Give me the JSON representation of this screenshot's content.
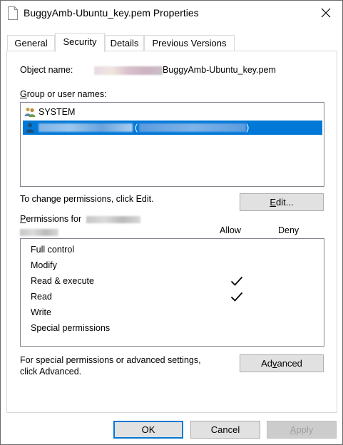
{
  "window": {
    "title": "BuggyAmb-Ubuntu_key.pem Properties"
  },
  "tabs": [
    {
      "label": "General"
    },
    {
      "label": "Security"
    },
    {
      "label": "Details"
    },
    {
      "label": "Previous Versions"
    }
  ],
  "security": {
    "object_name_label": "Object name:",
    "object_name_value": "BuggyAmb-Ubuntu_key.pem",
    "groups_label_prefix": "G",
    "groups_label_rest": "roup or user names:",
    "users": [
      {
        "name": "SYSTEM",
        "icon": "users-group-icon",
        "selected": false
      },
      {
        "name": "(",
        "name_end": ")",
        "icon": "user-icon",
        "selected": true
      }
    ],
    "change_text": "To change permissions, click Edit.",
    "edit_prefix": "E",
    "edit_rest": "dit...",
    "permissions_for_prefix": "P",
    "permissions_for_rest": "ermissions for",
    "allow_header": "Allow",
    "deny_header": "Deny",
    "permissions": [
      {
        "name": "Full control",
        "allow": false,
        "deny": false
      },
      {
        "name": "Modify",
        "allow": false,
        "deny": false
      },
      {
        "name": "Read & execute",
        "allow": true,
        "deny": false
      },
      {
        "name": "Read",
        "allow": true,
        "deny": false
      },
      {
        "name": "Write",
        "allow": false,
        "deny": false
      },
      {
        "name": "Special permissions",
        "allow": false,
        "deny": false
      }
    ],
    "advanced_text_line1": "For special permissions or advanced settings,",
    "advanced_text_line2": "click Advanced.",
    "advanced_prefix": "Ad",
    "advanced_u": "v",
    "advanced_rest": "anced"
  },
  "footer": {
    "ok_label": "OK",
    "cancel_label": "Cancel",
    "apply_prefix": "A",
    "apply_rest": "pply"
  },
  "colors": {
    "selection": "#0078d7",
    "button_face": "#e1e1e1"
  }
}
